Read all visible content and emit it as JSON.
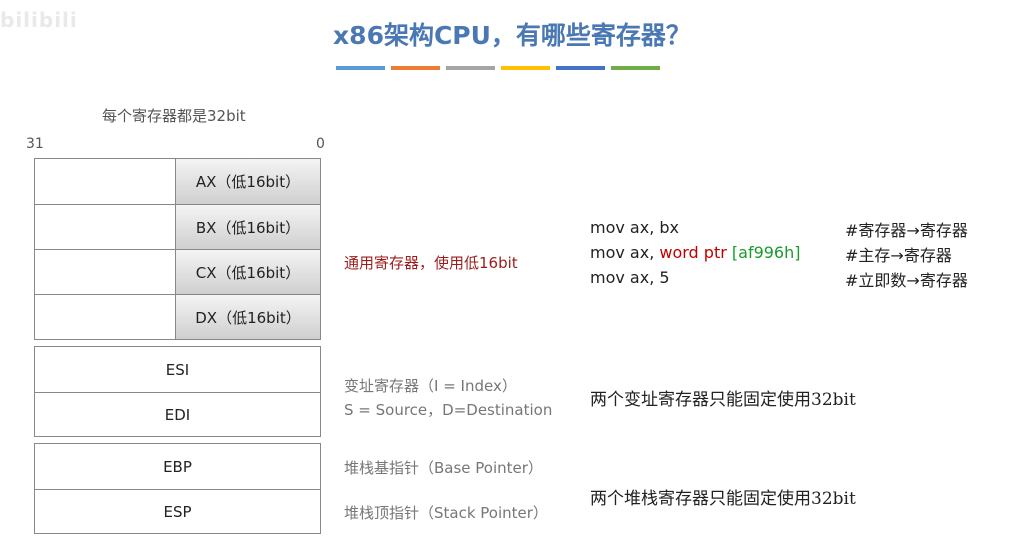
{
  "watermark": "bilibili",
  "title": "x86架构CPU，有哪些寄存器？",
  "stripe_colors": [
    "#5b9bd5",
    "#ed7d31",
    "#a5a5a5",
    "#ffc000",
    "#4472c4",
    "#70ad47"
  ],
  "caption": "每个寄存器都是32bit",
  "bit_high": "31",
  "bit_low": "0",
  "general_regs": [
    "AX（低16bit）",
    "BX（低16bit）",
    "CX（低16bit）",
    "DX（低16bit）"
  ],
  "index_regs": [
    "ESI",
    "EDI"
  ],
  "pointer_regs": [
    "EBP",
    "ESP"
  ],
  "general_desc": "通用寄存器，使用低16bit",
  "index_desc": [
    "变址寄存器（I = Index）",
    "S = Source，D=Destination"
  ],
  "pointer_desc": [
    "堆栈基指针（Base Pointer）",
    "堆栈顶指针（Stack Pointer）"
  ],
  "code": {
    "line1": "mov ax, bx",
    "line2_prefix": "mov ax, ",
    "line2_kw": "word ptr",
    "line2_addr": "[af996h]",
    "line3": "mov ax, 5"
  },
  "comments": [
    "#寄存器→寄存器",
    "#主存→寄存器",
    "#立即数→寄存器"
  ],
  "index_note": "两个变址寄存器只能固定使用32bit",
  "pointer_note": "两个堆栈寄存器只能固定使用32bit"
}
